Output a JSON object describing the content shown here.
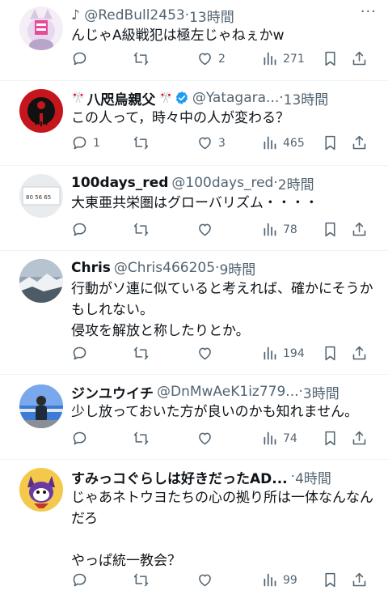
{
  "tweets": [
    {
      "name": "",
      "handle": "♪ @RedBull2453",
      "time": "13時間",
      "text": "んじゃA級戦犯は極左じゃねぇかw",
      "replies": "",
      "retweets": "",
      "likes": "2",
      "views": "271"
    },
    {
      "name": "八咫烏親父",
      "handle": "@Yatagara...",
      "time": "13時間",
      "text": "この人って，時々中の人が変わる？",
      "replies": "1",
      "retweets": "",
      "likes": "3",
      "views": "465"
    },
    {
      "name": "100days_red",
      "handle": "@100days_red",
      "time": "2時間",
      "text": "大東亜共栄圏はグローバリズム・・・・",
      "replies": "",
      "retweets": "",
      "likes": "",
      "views": "78"
    },
    {
      "name": "Chris",
      "handle": "@Chris466205",
      "time": "9時間",
      "text": "行動がソ連に似ていると考えれば、確かにそうかもしれない。\n侵攻を解放と称したりとか。",
      "replies": "",
      "retweets": "",
      "likes": "",
      "views": "194"
    },
    {
      "name": "ジンユウイチ",
      "handle": "@DnMwAeK1iz779...",
      "time": "3時間",
      "text": "少し放っておいた方が良いのかも知れません。",
      "replies": "",
      "retweets": "",
      "likes": "",
      "views": "74"
    },
    {
      "name": "すみっコぐらしは好きだったAD...",
      "handle": "",
      "time": "4時間",
      "text": "じゃあネトウヨたちの心の拠り所は一体なんなんだろ\n\nやっぱ統一教会？",
      "replies": "",
      "retweets": "",
      "likes": "",
      "views": "99"
    }
  ],
  "ui": {
    "dot": "·",
    "more": "···",
    "flag": "🎌",
    "accent_color": "#1d9bf0",
    "muted_color": "#536471"
  }
}
